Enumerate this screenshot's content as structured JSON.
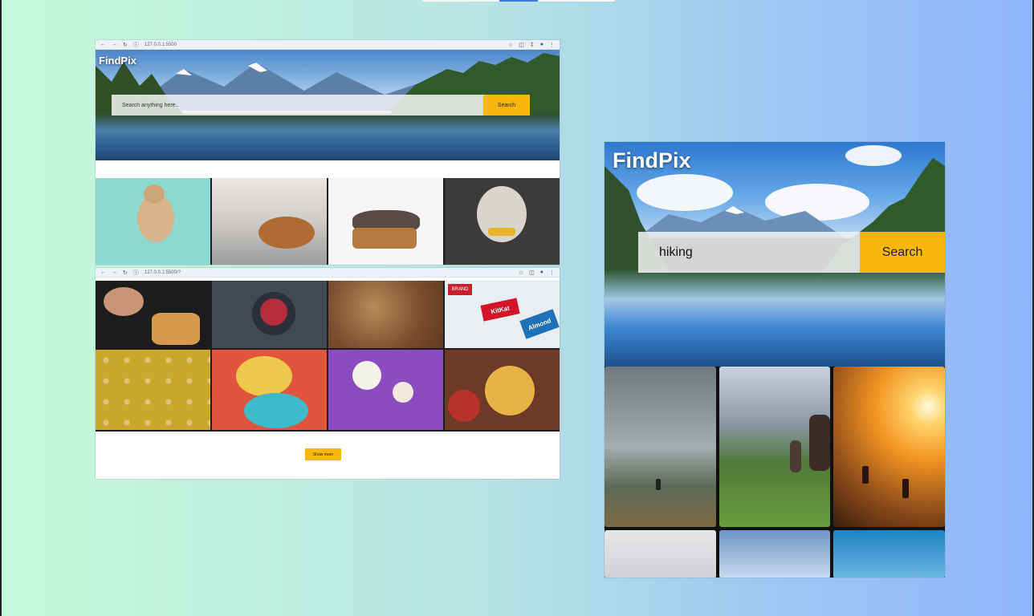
{
  "left_top": {
    "url": "127.0.0.1:5500",
    "brand": "FindPix",
    "search_placeholder": "Search anything here..",
    "search_button": "Search"
  },
  "left_bottom": {
    "url": "127.0.0.1:5500/?",
    "show_more": "Show more",
    "kitkat": "KitKat",
    "almond": "Almond",
    "brand_label": "BRAND"
  },
  "right": {
    "brand": "FindPix",
    "search_value": "hiking",
    "search_button": "Search"
  },
  "colors": {
    "accent": "#f8b70a",
    "bg_left": "#c6f9dc",
    "bg_right": "#8fb5fb"
  }
}
